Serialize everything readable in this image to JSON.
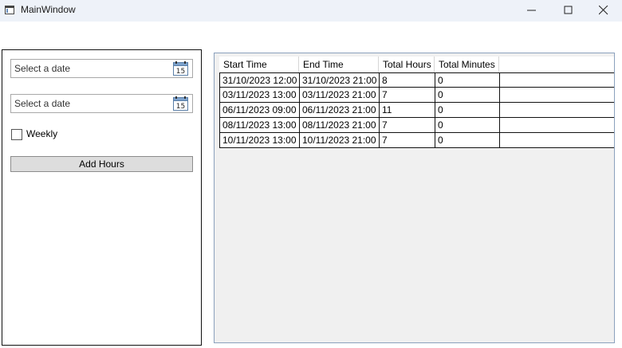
{
  "window": {
    "title": "MainWindow"
  },
  "left_panel": {
    "date_start": {
      "placeholder": "Select a date",
      "icon": "calendar-icon",
      "icon_text": "15"
    },
    "date_end": {
      "placeholder": "Select a date",
      "icon": "calendar-icon",
      "icon_text": "15"
    },
    "weekly": {
      "label": "Weekly",
      "checked": false
    },
    "add_button": {
      "label": "Add Hours"
    }
  },
  "grid": {
    "columns": [
      "Start Time",
      "End Time",
      "Total Hours",
      "Total Minutes"
    ],
    "rows": [
      [
        "31/10/2023 12:00",
        "31/10/2023 21:00",
        "8",
        "0"
      ],
      [
        "03/11/2023 13:00",
        "03/11/2023 21:00",
        "7",
        "0"
      ],
      [
        "06/11/2023 09:00",
        "06/11/2023 21:00",
        "11",
        "0"
      ],
      [
        "08/11/2023 13:00",
        "08/11/2023 21:00",
        "7",
        "0"
      ],
      [
        "10/11/2023 13:00",
        "10/11/2023 21:00",
        "7",
        "0"
      ]
    ]
  },
  "colors": {
    "titlebar": "#eef2f9",
    "grid_background": "#f0f0f0",
    "grid_border": "#8ba1bd",
    "button_background": "#dddddd"
  }
}
